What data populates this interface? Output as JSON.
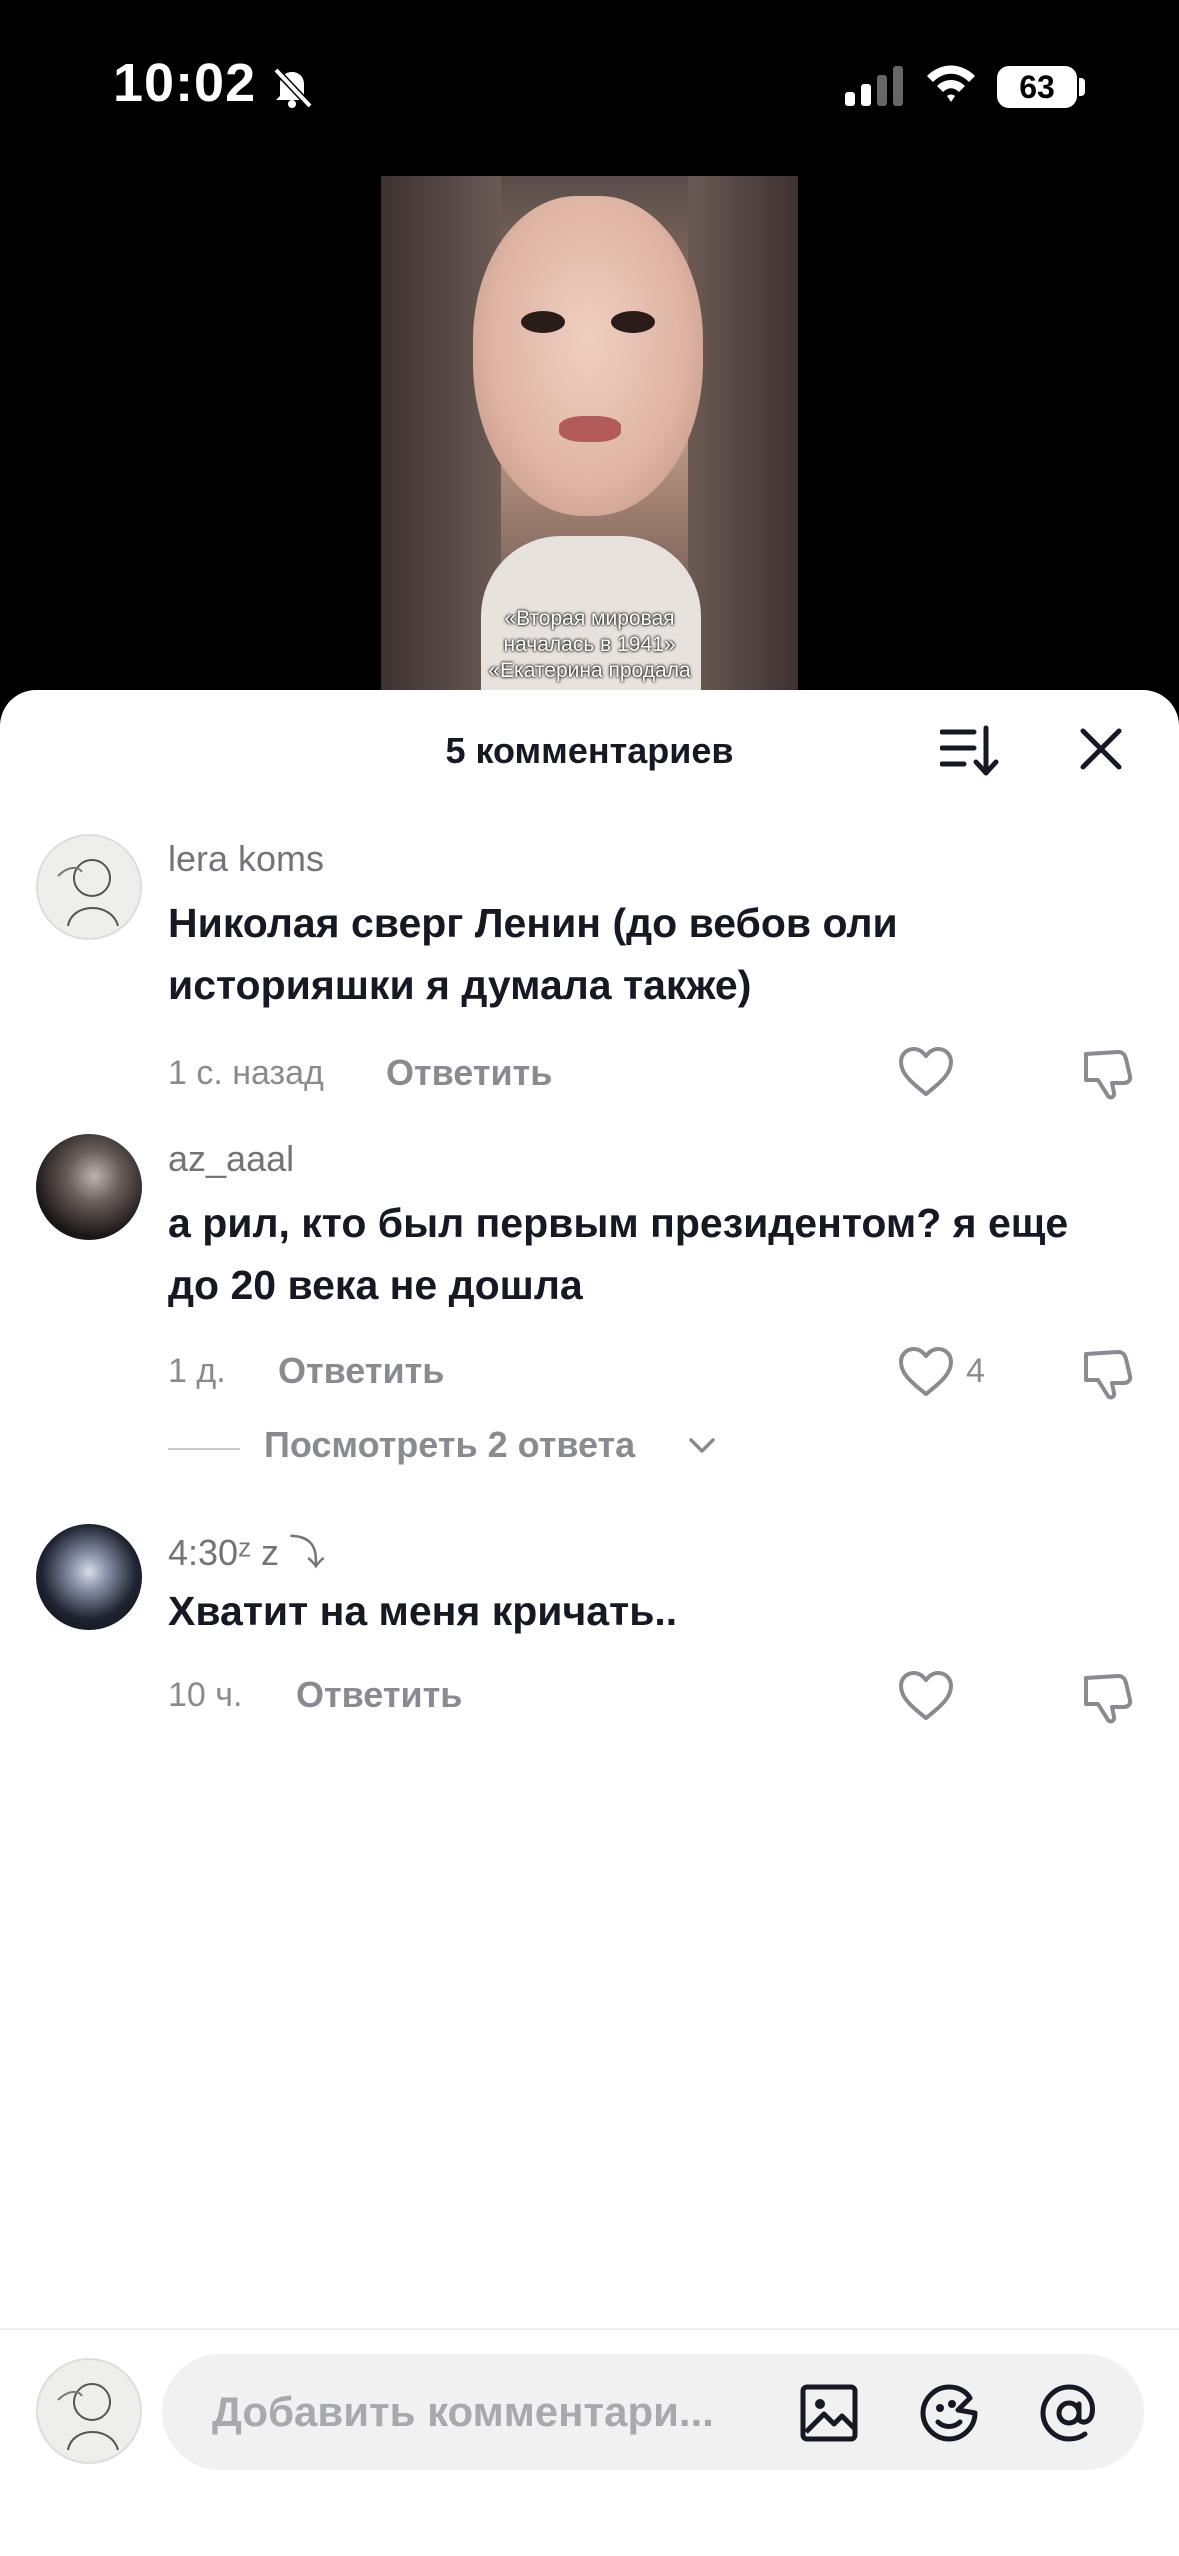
{
  "status_bar": {
    "time": "10:02",
    "battery": "63"
  },
  "video": {
    "caption_lines": [
      "«Вторая мировая",
      "началась в 1941»",
      "«Екатерина продала"
    ]
  },
  "sheet": {
    "title": "5 комментариев"
  },
  "comments": [
    {
      "username": "lera koms",
      "text": "Николая сверг Ленин (до вебов оли историяшки я думала также)",
      "time": "1 с. назад",
      "reply": "Ответить",
      "likes": ""
    },
    {
      "username": "az_aaal",
      "text": "а рил, кто был первым президентом? я еще до 20 века не дошла",
      "time": "1 д.",
      "reply": "Ответить",
      "likes": "4",
      "view_replies": "Посмотреть 2 ответа"
    },
    {
      "username": "4:30ᶻ z ⤵",
      "text": "Хватит на меня кричать..",
      "time": "10 ч.",
      "reply": "Ответить",
      "likes": ""
    }
  ],
  "input": {
    "placeholder": "Добавить комментари..."
  },
  "icons": [
    "bell-slash-icon",
    "signal-icon",
    "wifi-icon",
    "sort-icon",
    "close-icon",
    "heart-icon",
    "dislike-icon",
    "image-icon",
    "emoji-icon",
    "mention-icon"
  ]
}
